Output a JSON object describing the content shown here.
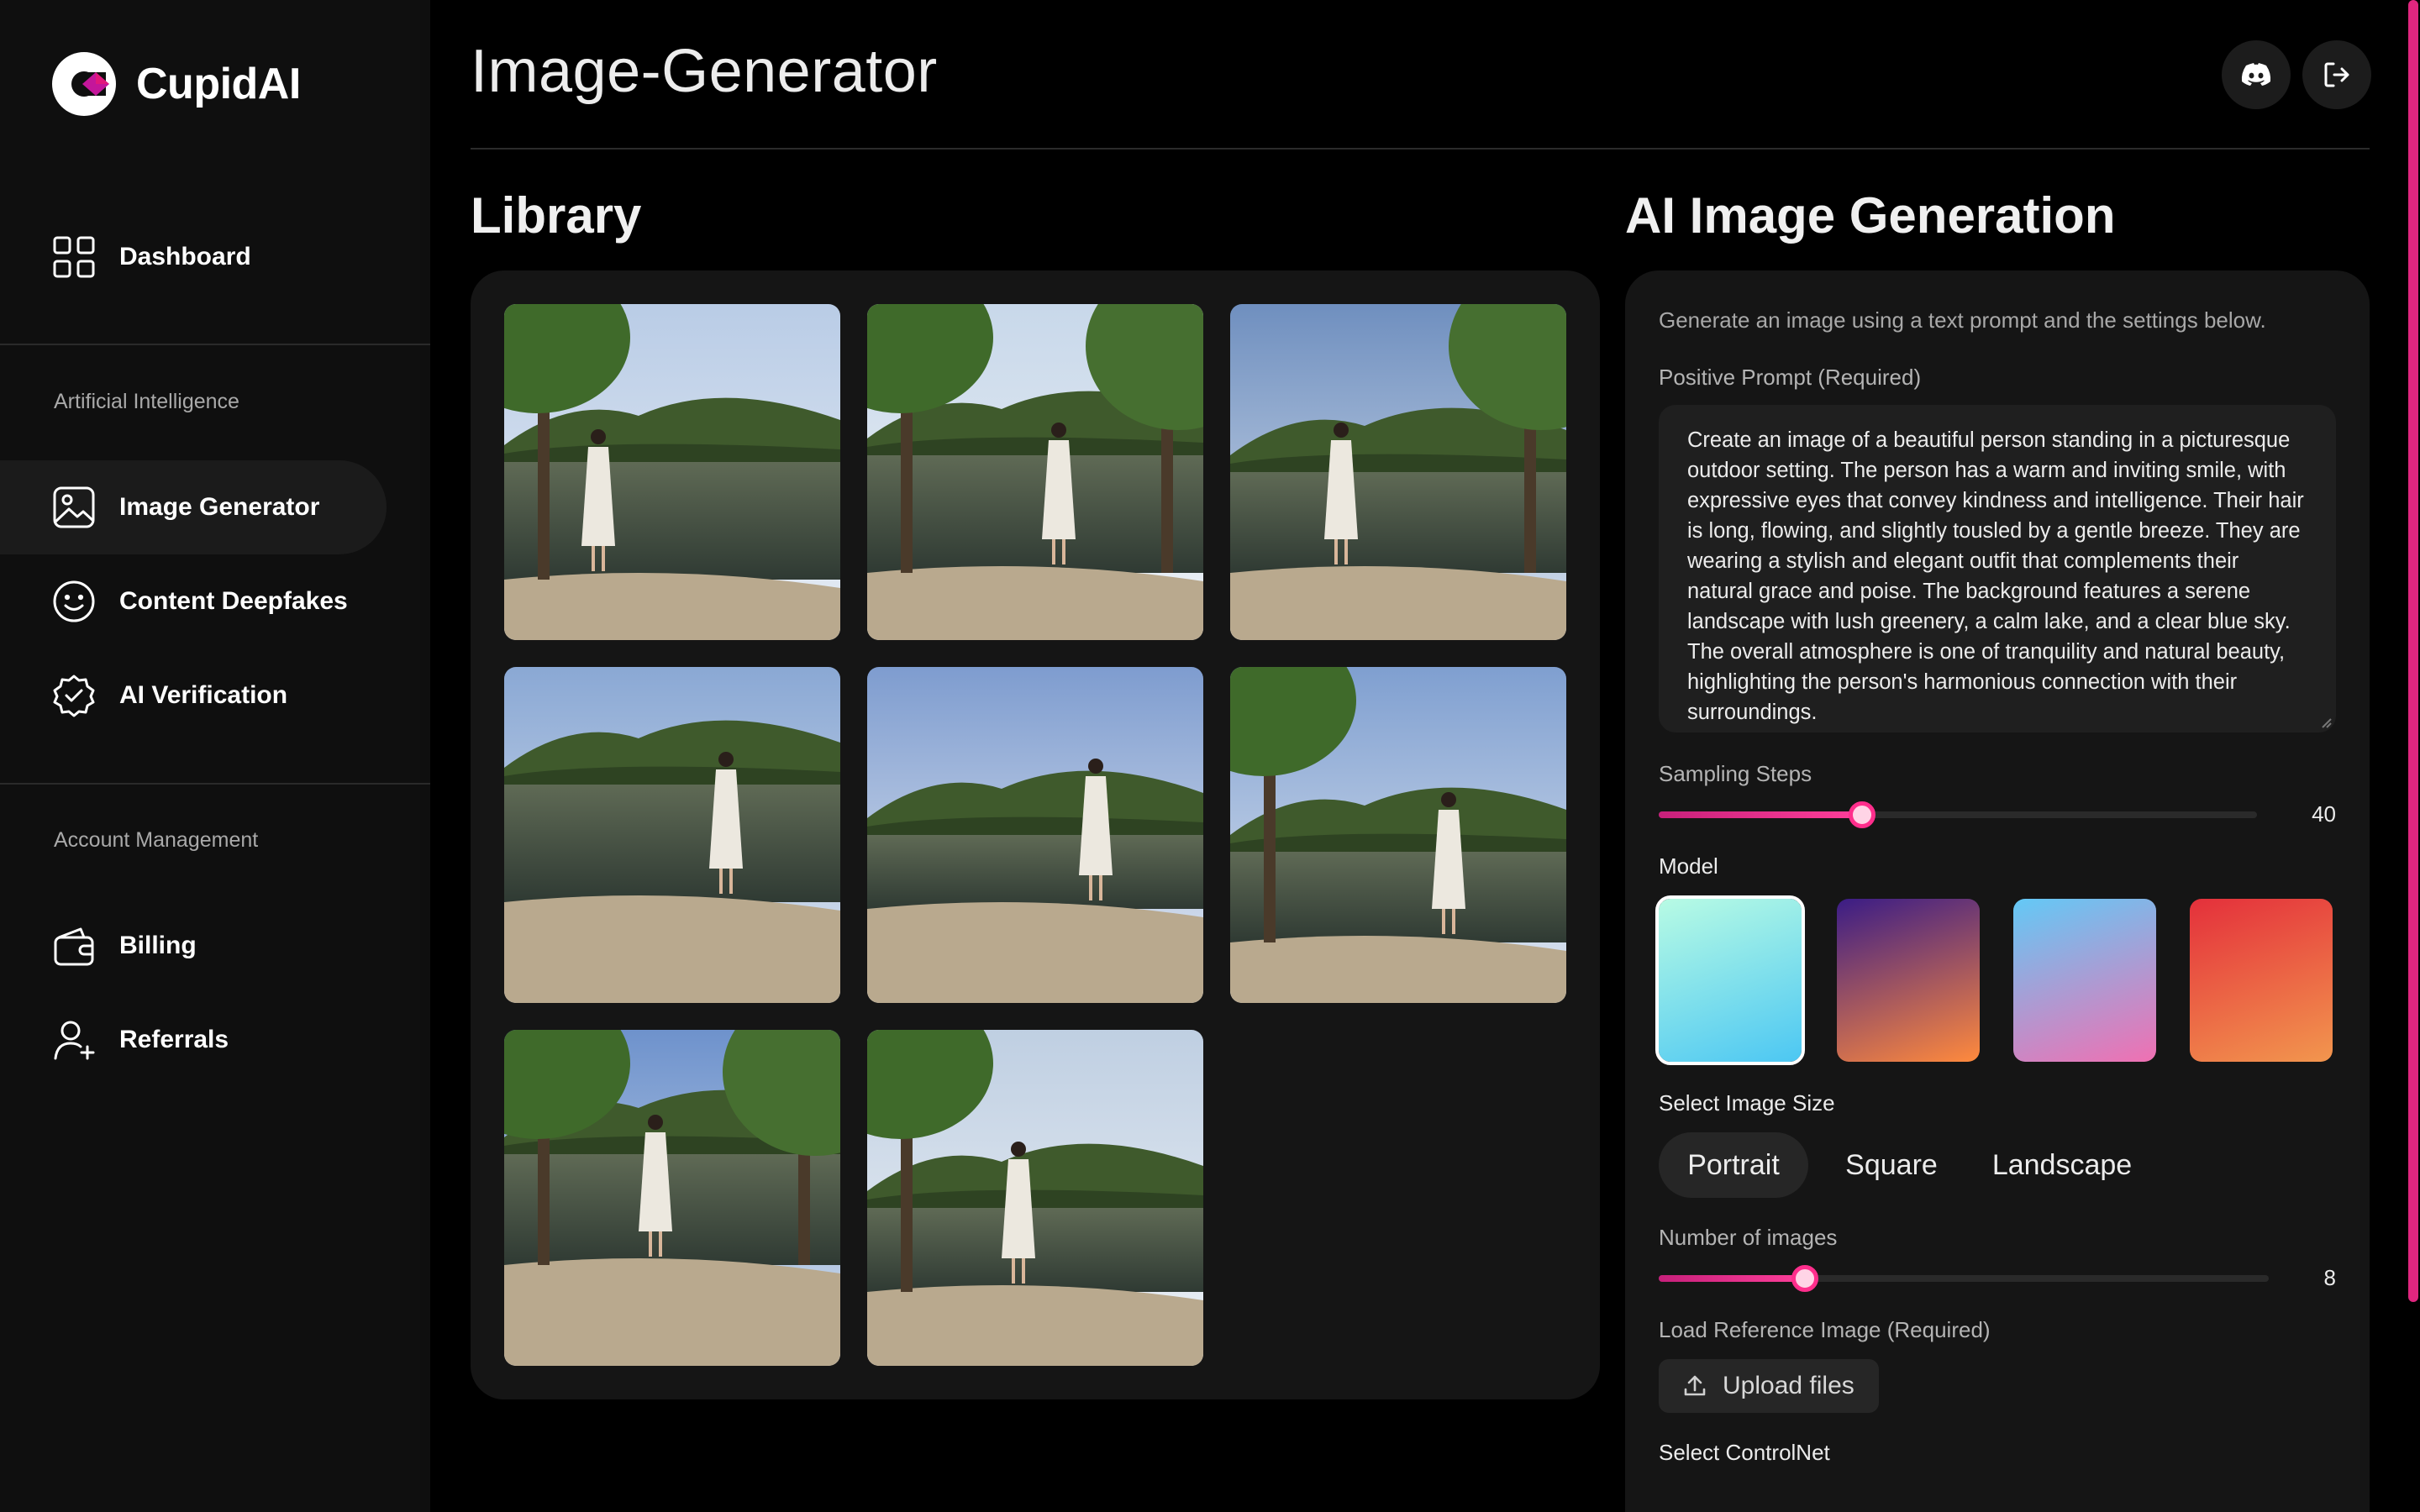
{
  "brand": {
    "name": "CupidAI"
  },
  "sidebar": {
    "top_items": [
      {
        "label": "Dashboard",
        "icon": "grid-icon"
      }
    ],
    "sections": [
      {
        "label": "Artificial Intelligence",
        "items": [
          {
            "label": "Image Generator",
            "icon": "image-icon",
            "active": true
          },
          {
            "label": "Content Deepfakes",
            "icon": "smiley-icon"
          },
          {
            "label": "AI Verification",
            "icon": "verified-badge-icon"
          }
        ]
      },
      {
        "label": "Account Management",
        "items": [
          {
            "label": "Billing",
            "icon": "wallet-icon"
          },
          {
            "label": "Referrals",
            "icon": "user-plus-icon"
          }
        ]
      }
    ]
  },
  "header": {
    "title": "Image-Generator",
    "actions": [
      {
        "icon": "discord-icon"
      },
      {
        "icon": "logout-icon"
      }
    ]
  },
  "library": {
    "title": "Library",
    "image_count": 8
  },
  "generation": {
    "title": "AI Image Generation",
    "intro": "Generate an image using a text prompt and the settings below.",
    "prompt_label": "Positive Prompt (Required)",
    "prompt_text": "Create an image of a beautiful person standing in a picturesque outdoor setting. The person has a warm and inviting smile, with expressive eyes that convey kindness and intelligence. Their hair is long, flowing, and slightly tousled by a gentle breeze. They are wearing a stylish and elegant outfit that complements their natural grace and poise. The background features a serene landscape with lush greenery, a calm lake, and a clear blue sky. The overall atmosphere is one of tranquility and natural beauty, highlighting the person's harmonious connection with their surroundings.",
    "sampling_steps": {
      "label": "Sampling Steps",
      "value": "40",
      "fraction": 0.34
    },
    "model": {
      "label": "Model",
      "options": [
        {
          "name": "model-aqua",
          "colors": [
            "#b8fbe4",
            "#4cc7f3"
          ],
          "selected": true
        },
        {
          "name": "model-violet",
          "colors": [
            "#3a1c86",
            "#ff8a3d"
          ]
        },
        {
          "name": "model-sky-pink",
          "colors": [
            "#63c9f6",
            "#f070b2"
          ]
        },
        {
          "name": "model-red-orange",
          "colors": [
            "#e4303b",
            "#f2964e"
          ]
        }
      ]
    },
    "image_size": {
      "label": "Select Image Size",
      "options": [
        "Portrait",
        "Square",
        "Landscape"
      ],
      "selected": "Portrait"
    },
    "num_images": {
      "label": "Number of images",
      "value": "8",
      "fraction": 0.24
    },
    "reference": {
      "label": "Load Reference Image (Required)",
      "button": "Upload files",
      "icon": "upload-icon"
    },
    "controlnet": {
      "label": "Select ControlNet"
    }
  },
  "colors": {
    "accent": "#ff2e8c",
    "background": "#000000",
    "sidebar": "#0f0f0f",
    "panel": "#151515"
  }
}
